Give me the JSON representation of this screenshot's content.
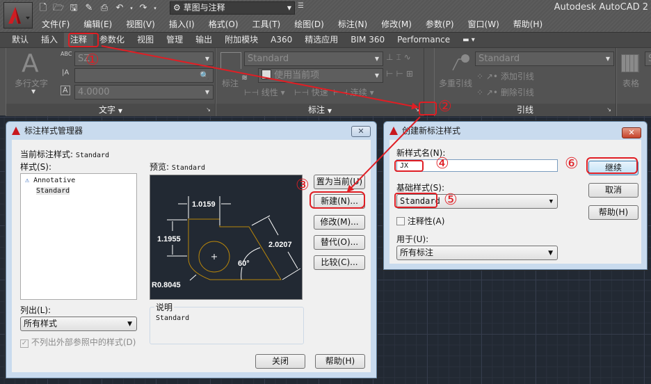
{
  "app": {
    "title": "Autodesk AutoCAD 2",
    "workspace": "草图与注释",
    "menu": [
      "文件(F)",
      "编辑(E)",
      "视图(V)",
      "插入(I)",
      "格式(O)",
      "工具(T)",
      "绘图(D)",
      "标注(N)",
      "修改(M)",
      "参数(P)",
      "窗口(W)",
      "帮助(H)"
    ],
    "quick_access_icons": [
      "new-icon",
      "open-icon",
      "save-icon",
      "save-as-icon",
      "print-icon",
      "undo-icon",
      "redo-icon"
    ]
  },
  "ribbon": {
    "tabs": [
      "默认",
      "插入",
      "注释",
      "参数化",
      "视图",
      "管理",
      "输出",
      "附加模块",
      "A360",
      "精选应用",
      "BIM 360",
      "Performance"
    ],
    "active_tab": "注释",
    "text_panel": {
      "title": "文字",
      "big_button": "多行文字",
      "text_style": "SZ",
      "find_text": "",
      "text_height": "4.0000"
    },
    "dim_panel": {
      "title": "标注",
      "big_button": "标注",
      "dim_style": "Standard",
      "layer": "使用当前项",
      "linear": "线性",
      "quick": "快速",
      "continue": "连续"
    },
    "leader_panel": {
      "title": "引线",
      "big_button": "多重引线",
      "leader_style": "Standard",
      "add_leader": "添加引线",
      "remove_leader": "删除引线"
    },
    "table_panel": {
      "big_button": "表格",
      "style": "S"
    }
  },
  "dim_style_manager": {
    "title": "标注样式管理器",
    "current_style_label": "当前标注样式:",
    "current_style": "Standard",
    "styles_label": "样式(S):",
    "styles": [
      "Annotative",
      "Standard"
    ],
    "selected_style": "Standard",
    "preview_label": "预览:",
    "preview_style": "Standard",
    "preview_dims": {
      "width": "1.0159",
      "height": "1.1955",
      "aligned": "2.0207",
      "angle": "60°",
      "radius": "R0.8045"
    },
    "buttons": {
      "set_current": "置为当前(U)",
      "new": "新建(N)...",
      "modify": "修改(M)...",
      "override": "替代(O)...",
      "compare": "比较(C)..."
    },
    "list_label": "列出(L):",
    "list_value": "所有样式",
    "exclude_xref_label": "不列出外部参照中的样式(D)",
    "exclude_xref_checked": true,
    "description_label": "说明",
    "description": "Standard",
    "close": "关闭",
    "help": "帮助(H)"
  },
  "create_new_style": {
    "title": "创建新标注样式",
    "new_name_label": "新样式名(N):",
    "new_name": "JX",
    "start_with_label": "基础样式(S):",
    "start_with": "Standard",
    "annotative_label": "注释性(A)",
    "annotative_checked": false,
    "use_for_label": "用于(U):",
    "use_for": "所有标注",
    "continue": "继续",
    "cancel": "取消",
    "help": "帮助(H)"
  },
  "annotations": [
    "①",
    "②",
    "③",
    "④",
    "⑤",
    "⑥"
  ],
  "colors": {
    "annotation_red": "#e01e24",
    "preview_geometry": "#b8860b",
    "autocad_red": "#c8161d"
  }
}
